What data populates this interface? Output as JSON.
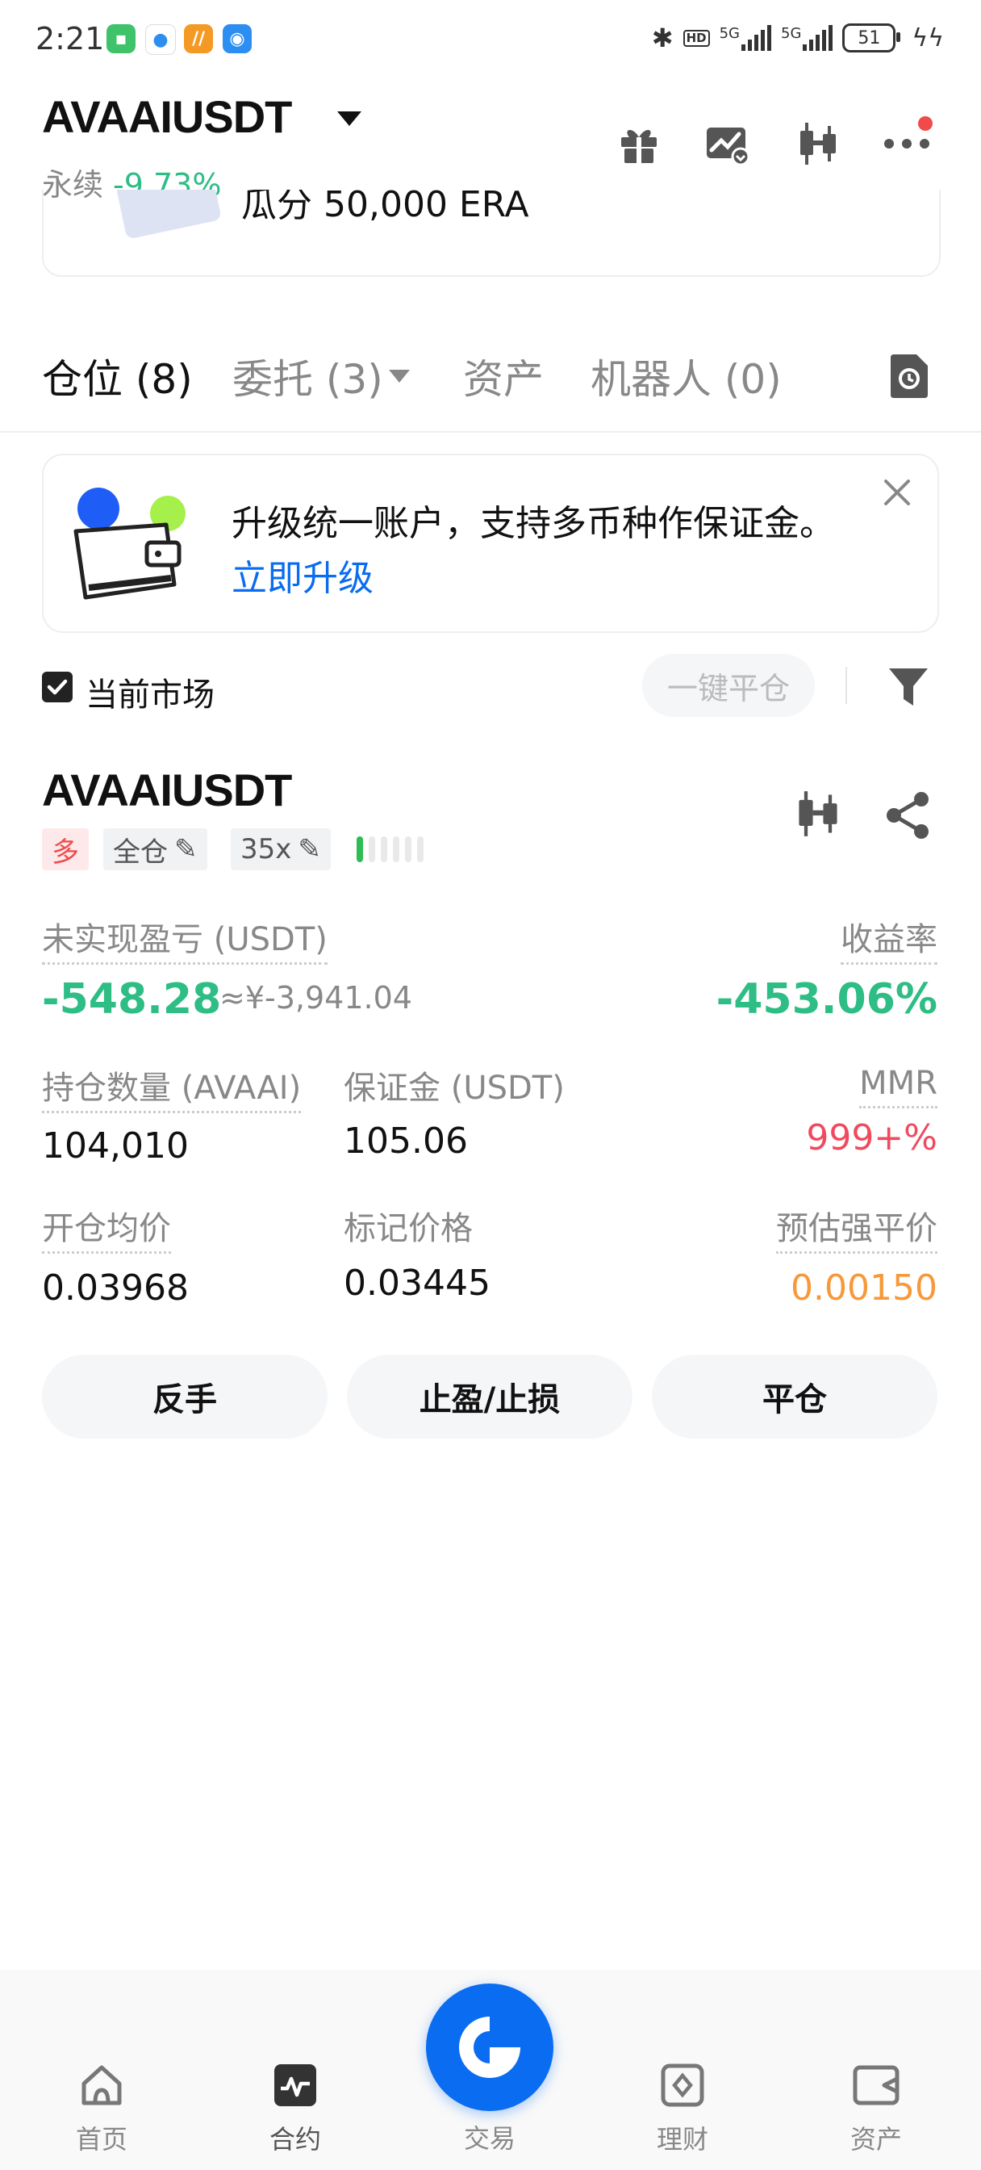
{
  "status_bar": {
    "time": "2:21",
    "network1": "5G",
    "network2": "5G",
    "hd_label": "HD",
    "battery": "51"
  },
  "header": {
    "symbol": "AVAAIUSDT",
    "contract_type": "永续",
    "change_24h": "-9.73%"
  },
  "banner": {
    "text": "瓜分 50,000 ERA"
  },
  "tabs": [
    {
      "label": "仓位",
      "count": "(8)"
    },
    {
      "label": "委托",
      "count": "(3)"
    },
    {
      "label": "资产",
      "count": ""
    },
    {
      "label": "机器人",
      "count": "(0)"
    }
  ],
  "upgrade_card": {
    "text": "升级统一账户，支持多币种作保证金。",
    "link": "立即升级"
  },
  "filter_row": {
    "current_market_label": "当前市场",
    "current_market_checked": true,
    "close_all_label": "一键平仓"
  },
  "position": {
    "symbol": "AVAAIUSDT",
    "side": "多",
    "margin_mode": "全仓",
    "leverage": "35x",
    "risk_level": 1,
    "risk_bars": 6,
    "unrealized_pnl_label": "未实现盈亏 (USDT)",
    "unrealized_pnl": "-548.28",
    "unrealized_pnl_cny": "≈¥-3,941.04",
    "roe_label": "收益率",
    "roe": "-453.06%",
    "size_label": "持仓数量 (AVAAI)",
    "size": "104,010",
    "margin_label": "保证金 (USDT)",
    "margin": "105.06",
    "mmr_label": "MMR",
    "mmr": "999+%",
    "entry_price_label": "开仓均价",
    "entry_price": "0.03968",
    "mark_price_label": "标记价格",
    "mark_price": "0.03445",
    "liq_price_label": "预估强平价",
    "liq_price": "0.00150"
  },
  "actions": {
    "reverse": "反手",
    "tp_sl": "止盈/止损",
    "close": "平仓"
  },
  "bottom_nav": [
    {
      "label": "首页",
      "icon": "home-icon"
    },
    {
      "label": "合约",
      "icon": "futures-icon"
    },
    {
      "label": "交易",
      "icon": "trade-icon"
    },
    {
      "label": "理财",
      "icon": "earn-icon"
    },
    {
      "label": "资产",
      "icon": "wallet-icon"
    }
  ],
  "colors": {
    "green": "#2ebd85",
    "red": "#f04a5e",
    "orange": "#f7993a",
    "blue": "#0a6cf0"
  }
}
